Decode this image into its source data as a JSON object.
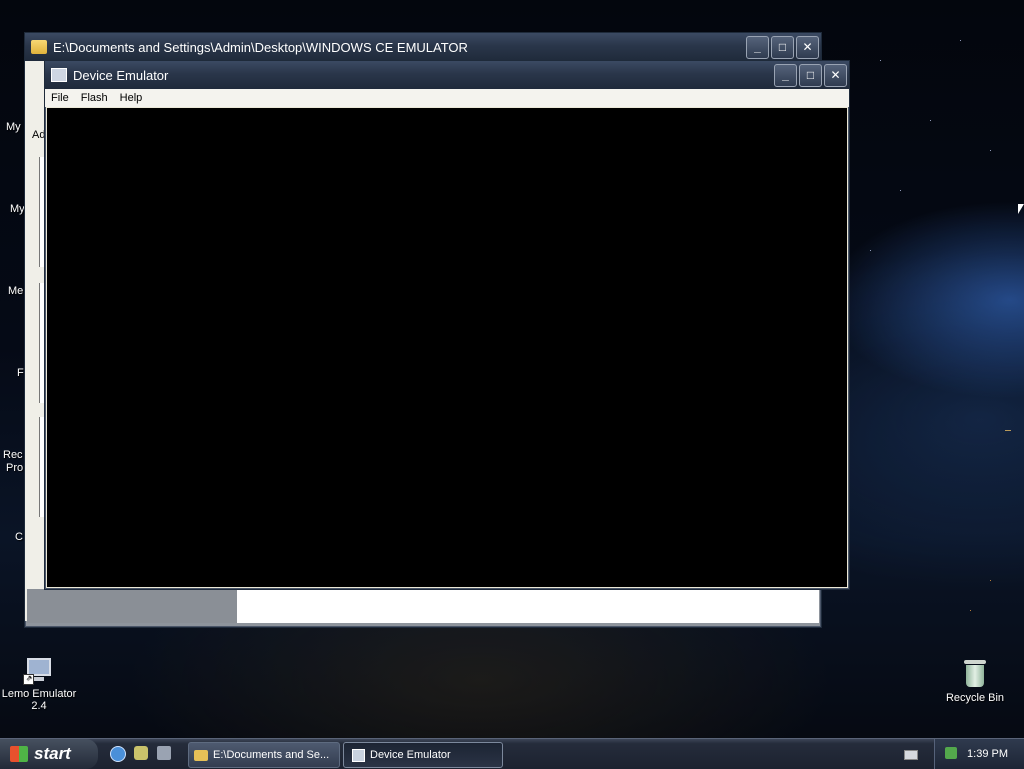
{
  "desktop": {
    "left_labels": [
      "My",
      "My",
      "Me",
      "F",
      "Rec",
      "Pro",
      "C"
    ],
    "icons": {
      "lemo_line1": "Lemo Emulator",
      "lemo_line2": "2.4",
      "recycle": "Recycle Bin"
    }
  },
  "explorer_window": {
    "title": "E:\\Documents and Settings\\Admin\\Desktop\\WINDOWS CE EMULATOR",
    "address_fragment": "Ad"
  },
  "emulator_window": {
    "title": "Device Emulator",
    "menu": [
      "File",
      "Flash",
      "Help"
    ]
  },
  "taskbar": {
    "start_label": "start",
    "tasks": [
      {
        "label": "E:\\Documents and Se..."
      },
      {
        "label": "Device Emulator"
      }
    ],
    "clock": "1:39 PM"
  },
  "colors": {
    "screen": "#000000",
    "titlebar": "#2a364a",
    "menubar": "#f4f3ee"
  }
}
